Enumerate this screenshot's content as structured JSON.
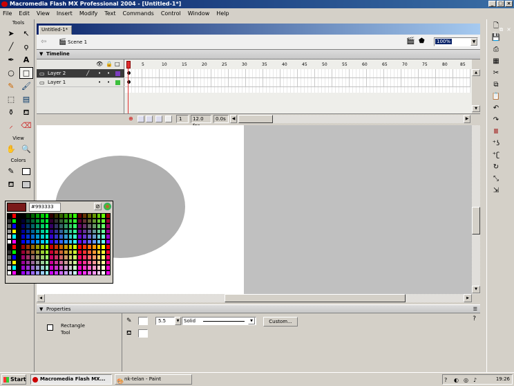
{
  "window": {
    "title": "Macromedia Flash MX Professional 2004 - [Untitled-1*]"
  },
  "menu": [
    "File",
    "Edit",
    "View",
    "Insert",
    "Modify",
    "Text",
    "Commands",
    "Control",
    "Window",
    "Help"
  ],
  "tools_panel": {
    "header": "Tools",
    "view_header": "View",
    "colors_header": "Colors"
  },
  "document": {
    "tab": "Untitled-1*",
    "scene": "Scene 1",
    "zoom": "100%"
  },
  "timeline": {
    "header": "Timeline",
    "layers": [
      {
        "name": "Layer 2",
        "selected": true
      },
      {
        "name": "Layer 1",
        "selected": false
      }
    ],
    "frame_numbers": [
      "5",
      "10",
      "15",
      "20",
      "25",
      "30",
      "35",
      "40",
      "45",
      "50",
      "55",
      "60",
      "65",
      "70",
      "75",
      "80",
      "85"
    ],
    "current_frame": "1",
    "fps": "12.0 fps",
    "time": "0.0s"
  },
  "color_popup": {
    "hex": "#993333",
    "selected_color": "#7a1a1a"
  },
  "properties": {
    "header": "Properties",
    "tool_name_line1": "Rectangle",
    "tool_name_line2": "Tool",
    "stroke_height": "5.5",
    "stroke_style": "Solid",
    "custom_button": "Custom..."
  },
  "taskbar": {
    "start": "Start",
    "tasks": [
      "Macromedia Flash MX...",
      "nk-telan - Paint"
    ],
    "clock": "19:26"
  },
  "colors": {
    "stage": "#ffffff",
    "ellipse": "#b0b0b0",
    "workarea": "#c0c0c0",
    "titlebar": "#0a246a",
    "playhead": "#e03030"
  }
}
